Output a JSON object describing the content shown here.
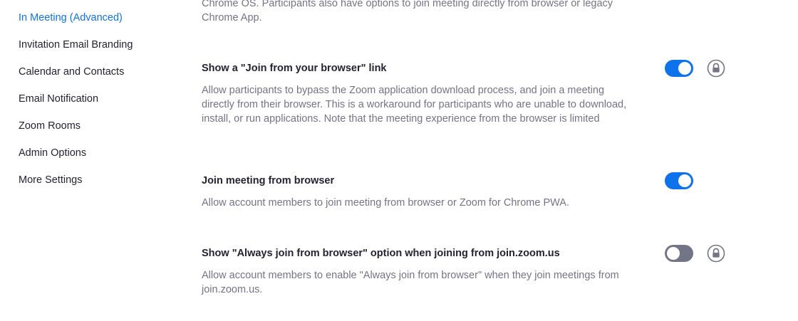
{
  "sidebar": {
    "items": [
      {
        "label": "In Meeting (Advanced)",
        "active": true
      },
      {
        "label": "Invitation Email Branding",
        "active": false
      },
      {
        "label": "Calendar and Contacts",
        "active": false
      },
      {
        "label": "Email Notification",
        "active": false
      },
      {
        "label": "Zoom Rooms",
        "active": false
      },
      {
        "label": "Admin Options",
        "active": false
      },
      {
        "label": "More Settings",
        "active": false
      }
    ]
  },
  "main": {
    "top_fragment": {
      "lines": [
        "Chrome OS. Participants also have options to join meeting directly from browser or legacy",
        "Chrome App."
      ]
    },
    "settings": [
      {
        "title": "Show a \"Join from your browser\" link",
        "description_lines": [
          "Allow participants to bypass the Zoom application download process, and join a meeting",
          "directly from their browser. This is a workaround for participants who are unable to download,",
          "install, or run applications. Note that the meeting experience from the browser is limited"
        ],
        "enabled": true,
        "lock_icon": "lock-icon"
      },
      {
        "title": "Join meeting from browser",
        "description_lines": [
          "Allow account members to join meeting from browser or Zoom for Chrome PWA."
        ],
        "enabled": true,
        "lock_icon": null
      },
      {
        "title": "Show \"Always join from browser\" option when joining from join.zoom.us",
        "description_lines": [
          "Allow account members to enable \"Always join from browser\" when they join meetings from",
          "join.zoom.us."
        ],
        "enabled": false,
        "lock_icon": "lock-icon"
      }
    ]
  },
  "colors": {
    "accent": "#0e72ed",
    "toggle_off": "#747487",
    "title_text": "#232333",
    "description_text": "#747487",
    "lock_icon": "#747487"
  }
}
